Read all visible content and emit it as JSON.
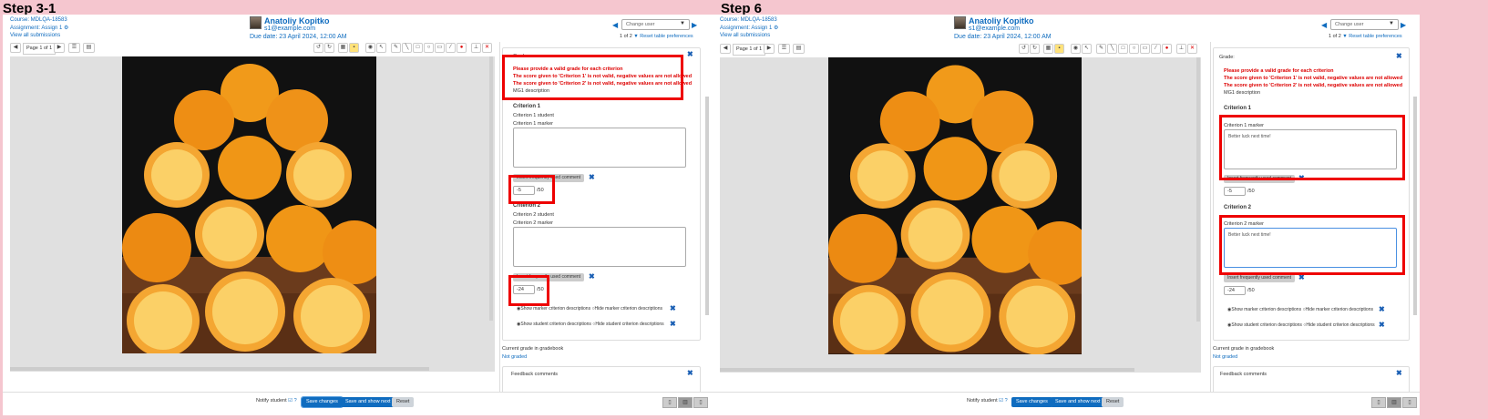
{
  "panels": [
    {
      "step_title": "Step 3-1",
      "course": "Course: MDLQA-18583",
      "assignment": "Assignment: Assign 1",
      "view_all": "View all submissions",
      "user_name": "Anatoliy Kopitko",
      "user_email": "s1@example.com",
      "due_date": "Due date: 23 April 2024, 12:00 AM",
      "change_user": "Change user",
      "pager_count": "1 of 2",
      "reset_table": "Reset table preferences",
      "page_label": "Page 1 of 1",
      "grade_heading": "Grade:",
      "errors": [
        "Please provide a valid grade for each criterion",
        "The score given to 'Criterion 1' is not valid, negative values are not allowed",
        "The score given to 'Criterion 2' is not valid, negative values are not allowed"
      ],
      "mg_desc": "MG1 description",
      "criteria": [
        {
          "title": "Criterion 1",
          "student": "Criterion 1 student",
          "marker": "Criterion 1 marker",
          "comment": "",
          "score": "-5",
          "outof": "/50",
          "insert": "Insert frequently used comment"
        },
        {
          "title": "Criterion 2",
          "student": "Criterion 2 student",
          "marker": "Criterion 2 marker",
          "comment": "",
          "score": "-24",
          "outof": "/50",
          "insert": "Insert frequently used comment"
        }
      ],
      "show_marker": "Show marker criterion descriptions",
      "hide_marker": "Hide marker criterion descriptions",
      "show_student": "Show student criterion descriptions",
      "hide_student": "Hide student criterion descriptions",
      "current_grade": "Current grade in gradebook",
      "not_graded": "Not graded",
      "feedback_comments": "Feedback comments",
      "notify": "Notify student",
      "save": "Save changes",
      "save_next": "Save and show next",
      "reset": "Reset"
    },
    {
      "step_title": "Step 6",
      "course": "Course: MDLQA-18583",
      "assignment": "Assignment: Assign 1",
      "view_all": "View all submissions",
      "user_name": "Anatoliy Kopitko",
      "user_email": "s1@example.com",
      "due_date": "Due date: 23 April 2024, 12:00 AM",
      "change_user": "Change user",
      "pager_count": "1 of 2",
      "reset_table": "Reset table preferences",
      "page_label": "Page 1 of 1",
      "grade_heading": "Grade:",
      "errors": [
        "Please provide a valid grade for each criterion",
        "The score given to 'Criterion 1' is not valid, negative values are not allowed",
        "The score given to 'Criterion 2' is not valid, negative values are not allowed"
      ],
      "mg_desc": "MG1 description",
      "criteria": [
        {
          "title": "Criterion 1",
          "student": "Criterion 1 student",
          "marker": "Criterion 1 marker",
          "comment": "Better luck next time!",
          "score": "-5",
          "outof": "/50",
          "insert": "Insert frequently used comment"
        },
        {
          "title": "Criterion 2",
          "student": "Criterion 2 student",
          "marker": "Criterion 2 marker",
          "comment": "Better luck next time!",
          "score": "-24",
          "outof": "/50",
          "insert": "Insert frequently used comment"
        }
      ],
      "show_marker": "Show marker criterion descriptions",
      "hide_marker": "Hide marker criterion descriptions",
      "show_student": "Show student criterion descriptions",
      "hide_student": "Hide student criterion descriptions",
      "current_grade": "Current grade in gradebook",
      "not_graded": "Not graded",
      "feedback_comments": "Feedback comments",
      "notify": "Notify student",
      "save": "Save changes",
      "save_next": "Save and show next",
      "reset": "Reset"
    }
  ],
  "colors": {
    "highlight": "#e00000",
    "link": "#0f6cbf",
    "error": "#dd0000",
    "background": "#f5c6cf"
  }
}
